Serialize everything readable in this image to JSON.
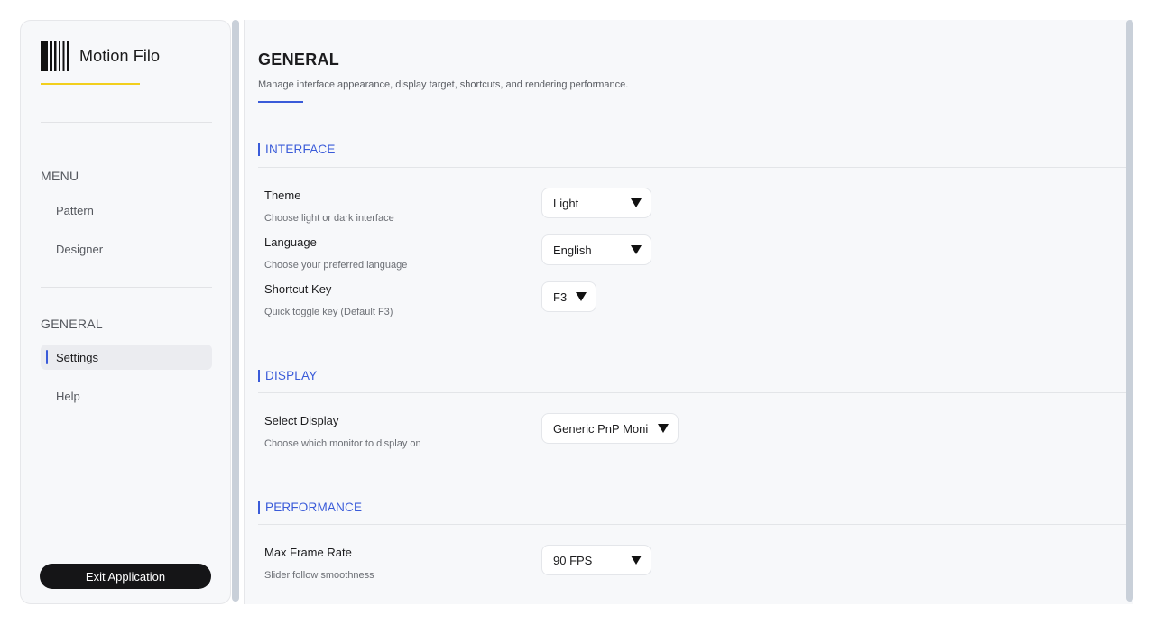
{
  "app": {
    "name": "Motion Filo"
  },
  "sidebar": {
    "menu_label": "MENU",
    "menu_items": [
      {
        "label": "Pattern"
      },
      {
        "label": "Designer"
      }
    ],
    "general_label": "GENERAL",
    "general_items": [
      {
        "label": "Settings",
        "active": true
      },
      {
        "label": "Help"
      }
    ],
    "exit_label": "Exit Application"
  },
  "page": {
    "title": "GENERAL",
    "subtitle": "Manage interface appearance, display target, shortcuts, and rendering performance."
  },
  "groups": {
    "interface": {
      "title": "INTERFACE",
      "settings": [
        {
          "name": "Theme",
          "description": "Choose light or dark interface",
          "value": "Light"
        },
        {
          "name": "Language",
          "description": "Choose your preferred language",
          "value": "English"
        },
        {
          "name": "Shortcut Key",
          "description": "Quick toggle key (Default F3)",
          "value": "F3"
        }
      ]
    },
    "display": {
      "title": "DISPLAY",
      "settings": [
        {
          "name": "Select Display",
          "description": "Choose which monitor to display on",
          "value": "Generic PnP Monitor"
        }
      ]
    },
    "performance": {
      "title": "PERFORMANCE",
      "settings": [
        {
          "name": "Max Frame Rate",
          "description": "Slider follow smoothness",
          "value": "90 FPS"
        }
      ]
    }
  },
  "colors": {
    "accent": "#3a5bd9",
    "logo_underline": "#f2cf1d",
    "exit_button": "#151517",
    "scrollbar": "#c9d0d9"
  }
}
